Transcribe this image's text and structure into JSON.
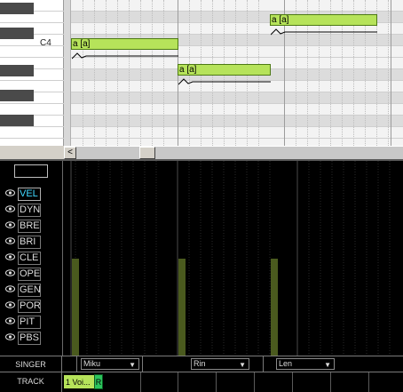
{
  "piano_roll": {
    "key_label": "C4",
    "scroll_left_glyph": "<",
    "notes": [
      {
        "lyric": "a [a]"
      },
      {
        "lyric": "a [a]"
      },
      {
        "lyric": "a [a]"
      }
    ]
  },
  "control_track": {
    "value_box": "",
    "active": "VEL",
    "controls": [
      {
        "label": "VEL"
      },
      {
        "label": "DYN"
      },
      {
        "label": "BRE"
      },
      {
        "label": "BRI"
      },
      {
        "label": "CLE"
      },
      {
        "label": "OPE"
      },
      {
        "label": "GEN"
      },
      {
        "label": "POR"
      },
      {
        "label": "PIT"
      },
      {
        "label": "PBS"
      }
    ]
  },
  "singer_bar": {
    "label": "SINGER",
    "singers": [
      "Miku",
      "Rin",
      "Len"
    ],
    "dropdown_glyph": "▼"
  },
  "track_bar": {
    "label": "TRACK",
    "track_tab": "1 Voi...",
    "record_label": "R"
  },
  "colors": {
    "note_fill": "#b6e35a",
    "velocity_bar": "#4a5a1e",
    "active_control_text": "#40d8ff"
  }
}
